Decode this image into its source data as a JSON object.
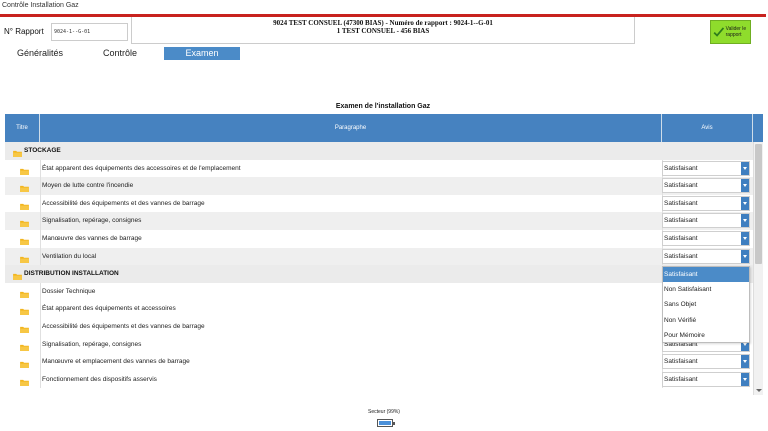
{
  "window": {
    "title": "Contrôle Installation Gaz"
  },
  "header": {
    "report_label": "N° Rapport",
    "report_number": "9024-1--G-01",
    "line1": "9024 TEST CONSUEL (47300 BIAS) - Numéro de rapport : 9024-1--G-01",
    "line2": "1 TEST CONSUEL - 456 BIAS",
    "validate_label": "Valider le rapport",
    "accent_color": "#c8221e"
  },
  "tabs": [
    {
      "label": "Généralités",
      "active": false
    },
    {
      "label": "Contrôle",
      "active": false
    },
    {
      "label": "Examen",
      "active": true
    }
  ],
  "table": {
    "title": "Examen de l'installation Gaz",
    "headers": {
      "titre": "Titre",
      "paragraphe": "Paragraphe",
      "avis": "Avis"
    },
    "groups": [
      {
        "name": "STOCKAGE",
        "rows": [
          {
            "paragraphe": "État apparent des équipements des accessoires et de l'emplacement",
            "avis": "Satisfaisant"
          },
          {
            "paragraphe": "Moyen de lutte contre l'incendie",
            "avis": "Satisfaisant"
          },
          {
            "paragraphe": "Accessibilité des équipements et des vannes de barrage",
            "avis": "Satisfaisant"
          },
          {
            "paragraphe": "Signalisation, repérage, consignes",
            "avis": "Satisfaisant"
          },
          {
            "paragraphe": "Manœuvre des vannes de barrage",
            "avis": "Satisfaisant"
          },
          {
            "paragraphe": "Ventilation du local",
            "avis": "Satisfaisant"
          }
        ]
      },
      {
        "name": "DISTRIBUTION INSTALLATION",
        "rows": [
          {
            "paragraphe": "Dossier Technique",
            "avis": ""
          },
          {
            "paragraphe": "État apparent des équipements et accessoires",
            "avis": ""
          },
          {
            "paragraphe": "Accessibilité des équipements et des vannes de barrage",
            "avis": ""
          },
          {
            "paragraphe": "Signalisation, repérage, consignes",
            "avis": "Satisfaisant"
          },
          {
            "paragraphe": "Manœuvre et emplacement des vannes de barrage",
            "avis": "Satisfaisant"
          },
          {
            "paragraphe": "Fonctionnement des dispositifs asservis",
            "avis": "Satisfaisant"
          }
        ]
      }
    ]
  },
  "dropdown": {
    "options": [
      "Satisfaisant",
      "Non Satisfaisant",
      "Sans Objet",
      "Non Vérifié",
      "Pour Mémoire"
    ],
    "selected_index": 0
  },
  "footer": {
    "power_label": "Secteur (99%)",
    "battery_percent": 99
  },
  "colors": {
    "header_blue": "#4682c0",
    "tab_active": "#4b8bc8",
    "validate_green": "#8fdc2c",
    "select_arrow": "#3f7fc0"
  },
  "icons": {
    "row_icon": "folder-icon",
    "validate_icon": "checkmark-icon",
    "battery_icon": "battery-icon"
  }
}
